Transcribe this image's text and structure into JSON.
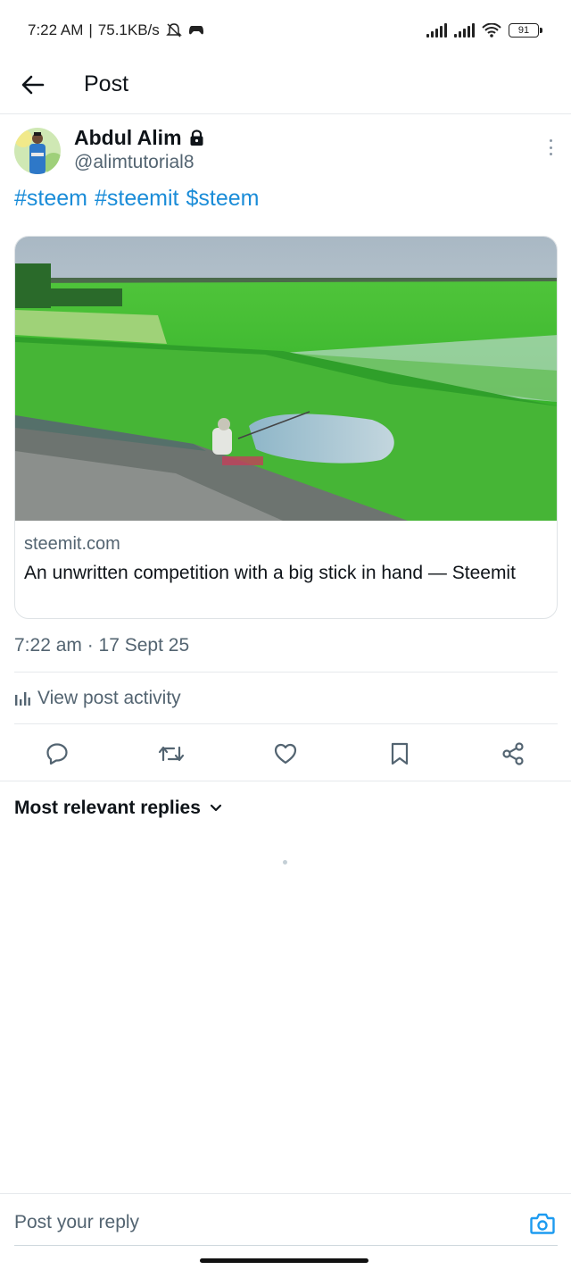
{
  "status_bar": {
    "time": "7:22 AM",
    "net_speed": "75.1KB/s",
    "battery": "91"
  },
  "header": {
    "title": "Post"
  },
  "post": {
    "author_name": "Abdul Alim",
    "handle": "@alimtutorial8",
    "hashtags": [
      "#steem",
      "#steemit",
      "$steem"
    ],
    "card": {
      "domain": "steemit.com",
      "title": "An unwritten competition with a big stick in hand — Steemit"
    },
    "timestamp": "7:22 am · 17 Sept 25",
    "activity_label": "View post activity"
  },
  "replies": {
    "sort_label": "Most relevant replies"
  },
  "composer": {
    "placeholder": "Post your reply"
  },
  "colors": {
    "accent": "#1d9bf0",
    "secondary_text": "#536471",
    "primary_text": "#0f1419"
  },
  "icons": {
    "back": "arrow-left-icon",
    "lock": "lock-icon",
    "more": "more-vertical-icon",
    "activity": "bar-chart-icon",
    "reply": "comment-icon",
    "repost": "repost-icon",
    "like": "heart-icon",
    "bookmark": "bookmark-icon",
    "share": "share-icon",
    "sort": "chevron-down-icon",
    "camera": "camera-icon"
  }
}
